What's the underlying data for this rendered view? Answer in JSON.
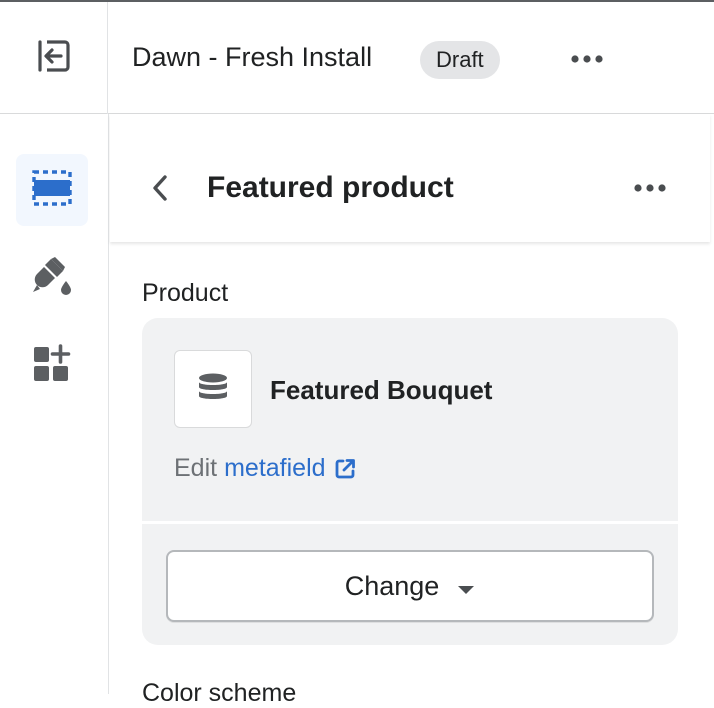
{
  "topbar": {
    "exit_icon": "exit-icon",
    "theme_name": "Dawn - Fresh Install",
    "status_badge": "Draft",
    "more_icon": "more-horizontal-icon"
  },
  "rail": {
    "items": [
      {
        "icon": "sections-icon",
        "active": true
      },
      {
        "icon": "theme-settings-paintbrush-icon",
        "active": false
      },
      {
        "icon": "app-embeds-icon",
        "active": false
      }
    ]
  },
  "panel": {
    "back_icon": "chevron-left-icon",
    "title": "Featured product",
    "more_icon": "more-horizontal-icon"
  },
  "product_setting": {
    "label": "Product",
    "product_name": "Featured Bouquet",
    "thumbnail_icon": "database-icon",
    "edit_prefix": "Edit",
    "edit_link": "metafield",
    "external_icon": "external-link-icon",
    "change_button": "Change",
    "caret_icon": "caret-down-icon"
  },
  "next_setting": {
    "label": "Color scheme"
  },
  "colors": {
    "accent_blue": "#2c6ecb",
    "rail_icon_active": "#2c6ecb",
    "rail_icon": "#5c5f62",
    "card_bg": "#f1f2f3",
    "badge_bg": "#e4e5e7"
  }
}
